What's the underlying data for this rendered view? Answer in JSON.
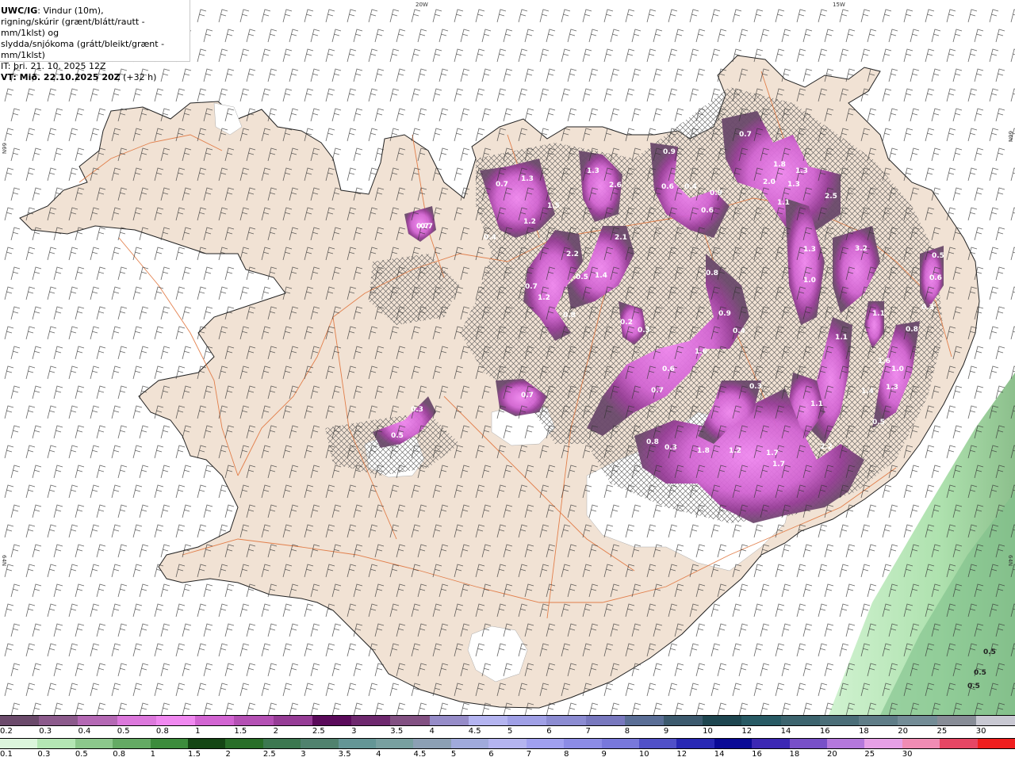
{
  "header": {
    "product": "UWC/IG",
    "line1_rest": ": Vindur (10m),",
    "line2": "rigning/skúrir (grænt/blátt/rautt - mm/1klst) og",
    "line3": "slydda/snjókoma (grátt/bleikt/grænt - mm/1klst)",
    "line4": "IT: þri. 21. 10. 2025 12Z",
    "valid_prefix": "VT: Mið. 22.10.2025 20Z",
    "valid_suffix": " (+32 h)"
  },
  "grid_labels": {
    "lon_20w": "20W",
    "lon_15w": "15W",
    "lat_66n_left": "66N",
    "lat_66n_right": "66N",
    "lat_64n_left": "64N",
    "lat_64n_right": "64N"
  },
  "precip_labels": [
    "0.7",
    "1.3",
    "1.3",
    "2.6",
    "0.9",
    "0.7",
    "1.8",
    "1.3",
    "0.7",
    "0.6",
    "0.4",
    "0.9",
    "2.0",
    "1.3",
    "2.5",
    "1.2",
    "1.5",
    "1.1",
    "0.7",
    "0.4",
    "0.6",
    "2.2",
    "2.1",
    "0.8",
    "1.3",
    "3.2",
    "0.5",
    "0.6",
    "0.7",
    "1.2",
    "0.5",
    "1.4",
    "0.8",
    "1.0",
    "0.2",
    "0.3",
    "0.9",
    "0.4",
    "1.1",
    "0.3",
    "0.8",
    "1.6",
    "1.1",
    "1.6",
    "1.0",
    "0.6",
    "0.7",
    "0.3",
    "1.4",
    "1.3",
    "0.7",
    "0.3",
    "1.1",
    "0.5",
    "0.5",
    "0.8",
    "0.3",
    "1.8",
    "1.2",
    "1.7",
    "1.7",
    "2.2"
  ],
  "ocean_labels": [
    "0.5",
    "0.5",
    "0.5"
  ],
  "legend": {
    "snow": {
      "colors": [
        "#6b4a6b",
        "#8c5a8c",
        "#b468b4",
        "#dc78dc",
        "#f088f0",
        "#d264d2",
        "#b450b4",
        "#963c96",
        "#5a0a5a",
        "#6e286e",
        "#825082",
        "#968cc8",
        "#b4b4f0",
        "#a0a0e6",
        "#8c8cd2",
        "#7878be",
        "#5a6e96",
        "#3c5a6e",
        "#1e4650",
        "#285a64",
        "#3c646e",
        "#4b6e78",
        "#5f7d87",
        "#738c96",
        "#878c96",
        "#c8c8d2"
      ],
      "labels": [
        "0.2",
        "0.3",
        "0.4",
        "0.5",
        "0.8",
        "1",
        "1.5",
        "2",
        "2.5",
        "3",
        "3.5",
        "4",
        "4.5",
        "5",
        "6",
        "7",
        "8",
        "9",
        "10",
        "12",
        "14",
        "16",
        "18",
        "20",
        "25",
        "30"
      ]
    },
    "rain": {
      "colors": [
        "#dcf5dc",
        "#b4e6b4",
        "#8cc88c",
        "#64aa64",
        "#3c8c3c",
        "#144614",
        "#286e28",
        "#3c7850",
        "#50826e",
        "#649696",
        "#78a0a0",
        "#8ca0b4",
        "#a0aadc",
        "#b4b4f0",
        "#a0a0f0",
        "#8c8ce6",
        "#7878dc",
        "#5050c8",
        "#2828b4",
        "#0a0a96",
        "#3c28b4",
        "#7850c8",
        "#b478dc",
        "#e6a0e6",
        "#f08cb4",
        "#e64664",
        "#f01e1e"
      ],
      "labels": [
        "0.1",
        "0.3",
        "0.5",
        "0.8",
        "1",
        "1.5",
        "2",
        "2.5",
        "3",
        "3.5",
        "4",
        "4.5",
        "5",
        "6",
        "7",
        "8",
        "9",
        "10",
        "12",
        "14",
        "16",
        "18",
        "20",
        "25",
        "30"
      ]
    }
  }
}
